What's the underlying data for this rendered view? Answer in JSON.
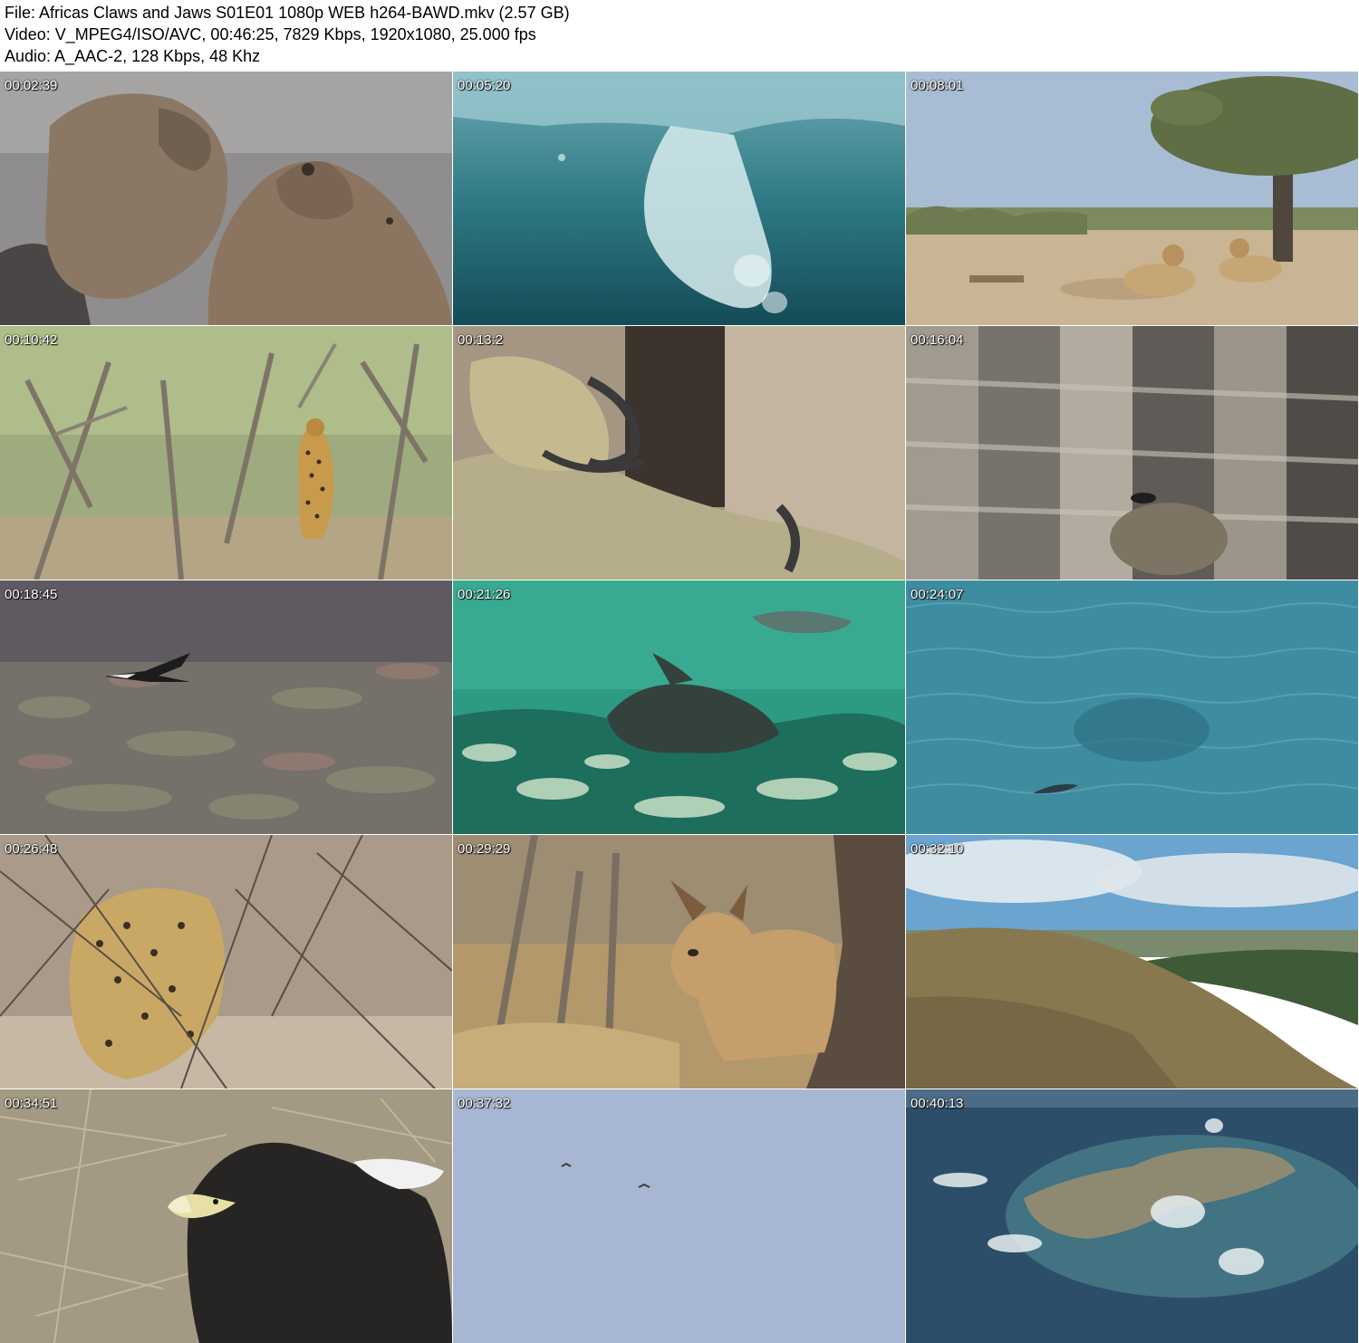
{
  "header": {
    "file_line": "File: Africas Claws and Jaws S01E01 1080p WEB h264-BAWD.mkv (2.57 GB)",
    "video_line": "Video: V_MPEG4/ISO/AVC, 00:46:25, 7829 Kbps, 1920x1080, 25.000 fps",
    "audio_line": "Audio: A_AAC-2, 128 Kbps, 48 Khz"
  },
  "thumbnails": [
    {
      "timestamp": "00:02:39",
      "scene": "fur-seals"
    },
    {
      "timestamp": "00:05:20",
      "scene": "underwater-bubbles"
    },
    {
      "timestamp": "00:08:01",
      "scene": "cheetahs-under-tree"
    },
    {
      "timestamp": "00:10:42",
      "scene": "leopard-in-bush"
    },
    {
      "timestamp": "00:13:2",
      "scene": "eagle-talons"
    },
    {
      "timestamp": "00:16:04",
      "scene": "cliff-nest"
    },
    {
      "timestamp": "00:18:45",
      "scene": "eagle-flying-low"
    },
    {
      "timestamp": "00:21:26",
      "scene": "seals-underwater"
    },
    {
      "timestamp": "00:24:07",
      "scene": "shark-in-ocean"
    },
    {
      "timestamp": "00:26:48",
      "scene": "leopard-in-thicket"
    },
    {
      "timestamp": "00:29:29",
      "scene": "caracal"
    },
    {
      "timestamp": "00:32:10",
      "scene": "hillside-landscape"
    },
    {
      "timestamp": "00:34:51",
      "scene": "eagle-on-nest"
    },
    {
      "timestamp": "00:37:32",
      "scene": "birds-in-sky"
    },
    {
      "timestamp": "00:40:13",
      "scene": "rocky-island"
    }
  ]
}
